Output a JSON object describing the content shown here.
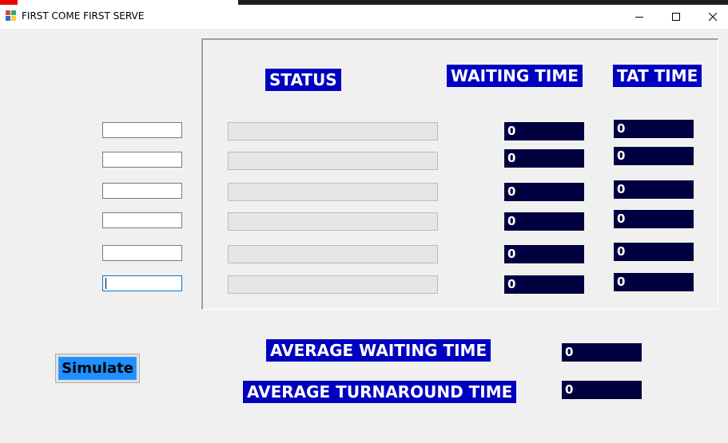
{
  "window": {
    "title": "FIRST COME FIRST SERVE"
  },
  "headers": {
    "status": "STATUS",
    "waiting_time": "WAITING TIME",
    "tat_time": "TAT TIME"
  },
  "rows": [
    {
      "waiting": "0",
      "tat": "0"
    },
    {
      "waiting": "0",
      "tat": "0"
    },
    {
      "waiting": "0",
      "tat": "0"
    },
    {
      "waiting": "0",
      "tat": "0"
    },
    {
      "waiting": "0",
      "tat": "0"
    },
    {
      "waiting": "0",
      "tat": "0"
    }
  ],
  "averages": {
    "waiting_label": "AVERAGE WAITING TIME",
    "waiting_value": "0",
    "turnaround_label": "AVERAGE TURNAROUND TIME",
    "turnaround_value": "0"
  },
  "actions": {
    "simulate": "Simulate"
  },
  "colors": {
    "header_bg": "#0000c0",
    "value_bg": "#000040",
    "button_bg": "#1e90ff"
  }
}
